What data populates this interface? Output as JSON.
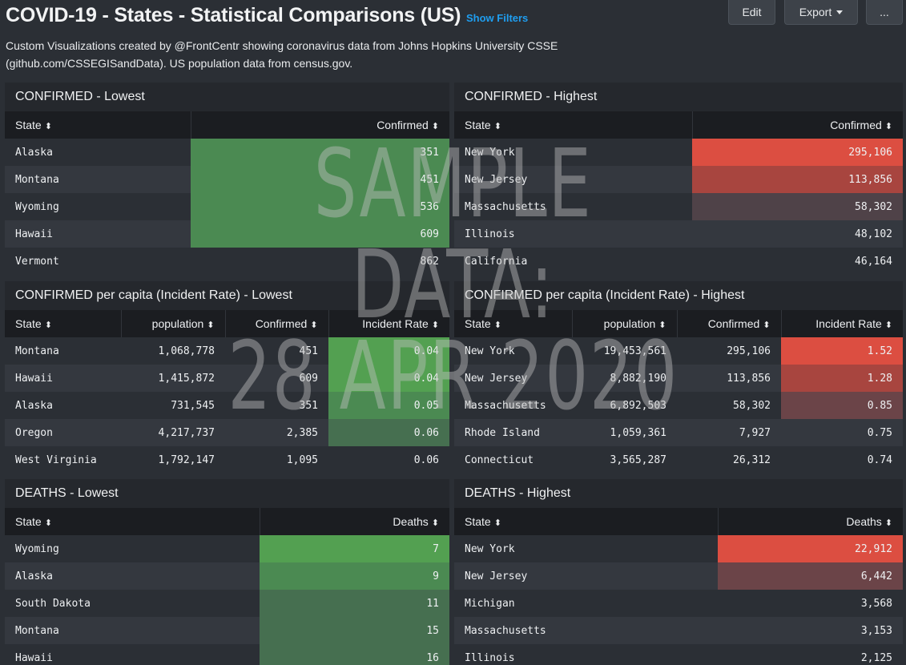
{
  "header": {
    "title": "COVID-19 - States - Statistical Comparisons (US)",
    "show_filters": "Show Filters",
    "edit_label": "Edit",
    "export_label": "Export",
    "more_label": "...",
    "description": "Custom Visualizations created by @FrontCentr showing coronavirus data from Johns Hopkins University CSSE (github.com/CSSEGISandData). US population data from census.gov."
  },
  "colors": {
    "green_strong": "#53a051",
    "green_mid": "#4b8a52",
    "green_soft": "#466f50",
    "red_strong": "#dc4e41",
    "red_mid": "#a8453f",
    "red_soft": "#6b4448",
    "red_faint": "#4f4248"
  },
  "watermark": {
    "line1": "SAMPLE",
    "line2": "DATA:",
    "line3": "28 APR 2020"
  },
  "panels": [
    {
      "id": "confirmed-lowest",
      "title": "CONFIRMED - Lowest",
      "columns": [
        "State",
        "Confirmed"
      ],
      "rows": [
        [
          "Alaska",
          "351"
        ],
        [
          "Montana",
          "451"
        ],
        [
          "Wyoming",
          "536"
        ],
        [
          "Hawaii",
          "609"
        ],
        [
          "Vermont",
          "862"
        ]
      ]
    },
    {
      "id": "confirmed-highest",
      "title": "CONFIRMED - Highest",
      "columns": [
        "State",
        "Confirmed"
      ],
      "rows": [
        [
          "New York",
          "295,106"
        ],
        [
          "New Jersey",
          "113,856"
        ],
        [
          "Massachusetts",
          "58,302"
        ],
        [
          "Illinois",
          "48,102"
        ],
        [
          "California",
          "46,164"
        ]
      ]
    },
    {
      "id": "incident-lowest",
      "title": "CONFIRMED per capita (Incident Rate) - Lowest",
      "columns": [
        "State",
        "population",
        "Confirmed",
        "Incident Rate"
      ],
      "rows": [
        [
          "Montana",
          "1,068,778",
          "451",
          "0.04"
        ],
        [
          "Hawaii",
          "1,415,872",
          "609",
          "0.04"
        ],
        [
          "Alaska",
          "731,545",
          "351",
          "0.05"
        ],
        [
          "Oregon",
          "4,217,737",
          "2,385",
          "0.06"
        ],
        [
          "West Virginia",
          "1,792,147",
          "1,095",
          "0.06"
        ]
      ]
    },
    {
      "id": "incident-highest",
      "title": "CONFIRMED per capita (Incident Rate) - Highest",
      "columns": [
        "State",
        "population",
        "Confirmed",
        "Incident Rate"
      ],
      "rows": [
        [
          "New York",
          "19,453,561",
          "295,106",
          "1.52"
        ],
        [
          "New Jersey",
          "8,882,190",
          "113,856",
          "1.28"
        ],
        [
          "Massachusetts",
          "6,892,503",
          "58,302",
          "0.85"
        ],
        [
          "Rhode Island",
          "1,059,361",
          "7,927",
          "0.75"
        ],
        [
          "Connecticut",
          "3,565,287",
          "26,312",
          "0.74"
        ]
      ]
    },
    {
      "id": "deaths-lowest",
      "title": "DEATHS - Lowest",
      "columns": [
        "State",
        "Deaths"
      ],
      "rows": [
        [
          "Wyoming",
          "7"
        ],
        [
          "Alaska",
          "9"
        ],
        [
          "South Dakota",
          "11"
        ],
        [
          "Montana",
          "15"
        ],
        [
          "Hawaii",
          "16"
        ]
      ]
    },
    {
      "id": "deaths-highest",
      "title": "DEATHS - Highest",
      "columns": [
        "State",
        "Deaths"
      ],
      "rows": [
        [
          "New York",
          "22,912"
        ],
        [
          "New Jersey",
          "6,442"
        ],
        [
          "Michigan",
          "3,568"
        ],
        [
          "Massachusetts",
          "3,153"
        ],
        [
          "Illinois",
          "2,125"
        ]
      ]
    }
  ]
}
